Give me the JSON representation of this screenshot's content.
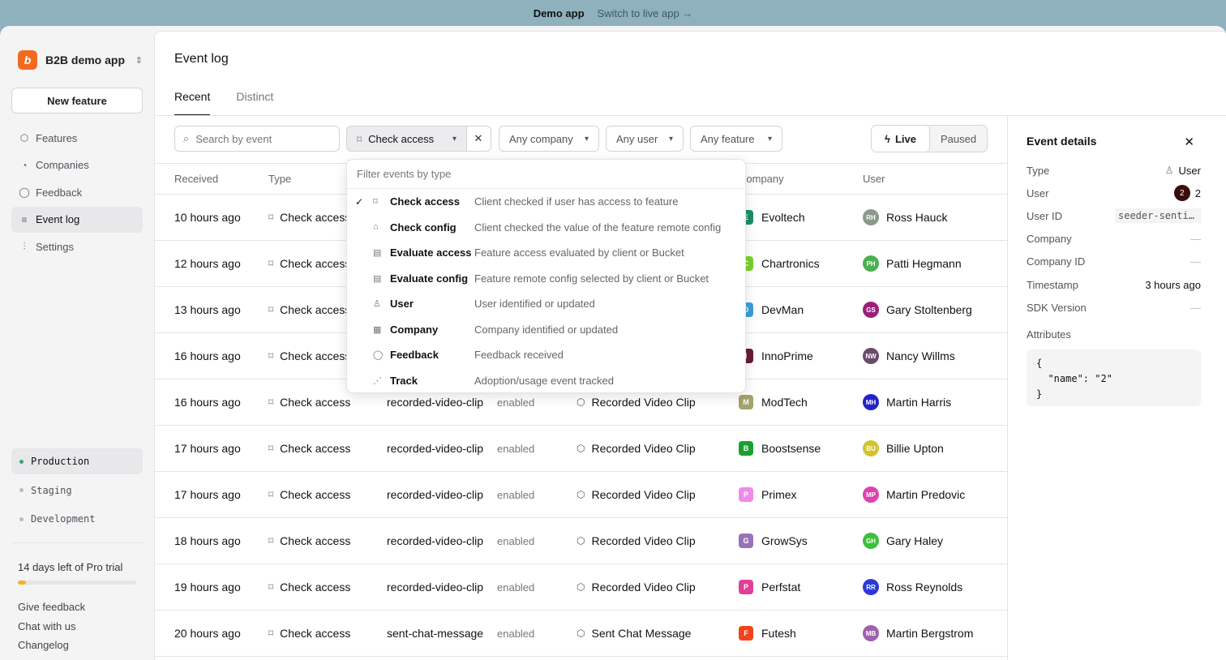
{
  "banner": {
    "demo": "Demo app",
    "switch": "Switch to live app →"
  },
  "sidebar": {
    "workspace": "B2B demo app",
    "logo_letter": "b",
    "new_feature": "New feature",
    "nav": [
      {
        "label": "Features",
        "icon": "⬡"
      },
      {
        "label": "Companies",
        "icon": "◔"
      },
      {
        "label": "Feedback",
        "icon": "◯"
      },
      {
        "label": "Event log",
        "icon": "≡"
      },
      {
        "label": "Settings",
        "icon": "⫶"
      }
    ],
    "environments": [
      "Production",
      "Staging",
      "Development"
    ],
    "trial": "14 days left of Pro trial",
    "trial_progress": 0.07,
    "links": [
      "Give feedback",
      "Chat with us",
      "Changelog"
    ]
  },
  "page": {
    "title": "Event log",
    "tabs": [
      "Recent",
      "Distinct"
    ]
  },
  "filters": {
    "search_placeholder": "Search by event",
    "type": "Check access",
    "company": "Any company",
    "user": "Any user",
    "feature": "Any feature",
    "live": "Live",
    "paused": "Paused"
  },
  "table": {
    "headers": [
      "Received",
      "Type",
      "",
      "",
      "",
      "Company",
      "User"
    ],
    "rows": [
      {
        "received": "10 hours ago",
        "type": "Check access",
        "key": "",
        "status": "",
        "feature": "",
        "company": "Evoltech",
        "cl": "E",
        "cc": "#1a8f6b",
        "user": "Ross Hauck",
        "ui": "RH",
        "uc": "#8a9a8a"
      },
      {
        "received": "12 hours ago",
        "type": "Check access",
        "key": "",
        "status": "",
        "feature": "",
        "company": "Chartronics",
        "cl": "C",
        "cc": "#7ad12e",
        "user": "Patti Hegmann",
        "ui": "PH",
        "uc": "#4caf50"
      },
      {
        "received": "13 hours ago",
        "type": "Check access",
        "key": "",
        "status": "",
        "feature": "",
        "company": "DevMan",
        "cl": "D",
        "cc": "#3aa0d8",
        "user": "Gary Stoltenberg",
        "ui": "GS",
        "uc": "#9c1f7a"
      },
      {
        "received": "16 hours ago",
        "type": "Check access",
        "key": "",
        "status": "",
        "feature": "",
        "company": "InnoPrime",
        "cl": "I",
        "cc": "#6b1a3a",
        "user": "Nancy Willms",
        "ui": "NW",
        "uc": "#6a4a6a"
      },
      {
        "received": "16 hours ago",
        "type": "Check access",
        "key": "recorded-video-clip",
        "status": "enabled",
        "feature": "Recorded Video Clip",
        "company": "ModTech",
        "cl": "M",
        "cc": "#a3a36b",
        "user": "Martin Harris",
        "ui": "MH",
        "uc": "#2222cc"
      },
      {
        "received": "17 hours ago",
        "type": "Check access",
        "key": "recorded-video-clip",
        "status": "enabled",
        "feature": "Recorded Video Clip",
        "company": "Boostsense",
        "cl": "B",
        "cc": "#1aa02e",
        "user": "Billie Upton",
        "ui": "BU",
        "uc": "#d4c42a"
      },
      {
        "received": "17 hours ago",
        "type": "Check access",
        "key": "recorded-video-clip",
        "status": "enabled",
        "feature": "Recorded Video Clip",
        "company": "Primex",
        "cl": "P",
        "cc": "#f08ae8",
        "user": "Martin Predovic",
        "ui": "MP",
        "uc": "#e040b0"
      },
      {
        "received": "18 hours ago",
        "type": "Check access",
        "key": "recorded-video-clip",
        "status": "enabled",
        "feature": "Recorded Video Clip",
        "company": "GrowSys",
        "cl": "G",
        "cc": "#9a72b8",
        "user": "Gary Haley",
        "ui": "GH",
        "uc": "#3ac03a"
      },
      {
        "received": "19 hours ago",
        "type": "Check access",
        "key": "recorded-video-clip",
        "status": "enabled",
        "feature": "Recorded Video Clip",
        "company": "Perfstat",
        "cl": "P",
        "cc": "#e0409a",
        "user": "Ross Reynolds",
        "ui": "RR",
        "uc": "#2a3ad8"
      },
      {
        "received": "20 hours ago",
        "type": "Check access",
        "key": "sent-chat-message",
        "status": "enabled",
        "feature": "Sent Chat Message",
        "company": "Futesh",
        "cl": "F",
        "cc": "#f0441a",
        "user": "Martin Bergstrom",
        "ui": "MB",
        "uc": "#a060b0"
      }
    ]
  },
  "dropdown": {
    "header": "Filter events by type",
    "options": [
      {
        "name": "Check access",
        "desc": "Client checked if user has access to feature",
        "icon": "⌑",
        "checked": true
      },
      {
        "name": "Check config",
        "desc": "Client checked the value of the feature remote config",
        "icon": "⌂",
        "checked": false
      },
      {
        "name": "Evaluate access",
        "desc": "Feature access evaluated by client or Bucket",
        "icon": "▤",
        "checked": false
      },
      {
        "name": "Evaluate config",
        "desc": "Feature remote config selected by client or Bucket",
        "icon": "▤",
        "checked": false
      },
      {
        "name": "User",
        "desc": "User identified or updated",
        "icon": "♙",
        "checked": false
      },
      {
        "name": "Company",
        "desc": "Company identified or updated",
        "icon": "▦",
        "checked": false
      },
      {
        "name": "Feedback",
        "desc": "Feedback received",
        "icon": "◯",
        "checked": false
      },
      {
        "name": "Track",
        "desc": "Adoption/usage event tracked",
        "icon": "⋰",
        "checked": false
      }
    ]
  },
  "details": {
    "title": "Event details",
    "type_label": "Type",
    "type_value": "User",
    "user_label": "User",
    "user_badge": "2",
    "user_value": "2",
    "userid_label": "User ID",
    "userid_value": "seeder-sentinel",
    "company_label": "Company",
    "company_value": "—",
    "companyid_label": "Company ID",
    "companyid_value": "—",
    "timestamp_label": "Timestamp",
    "timestamp_value": "3 hours ago",
    "sdk_label": "SDK Version",
    "sdk_value": "—",
    "attributes_label": "Attributes",
    "attributes": "{\n  \"name\": \"2\"\n}"
  }
}
